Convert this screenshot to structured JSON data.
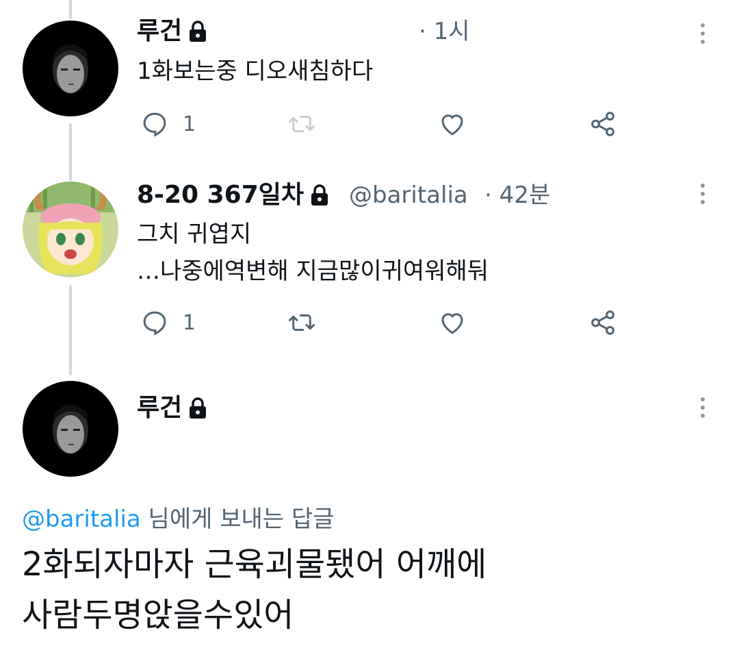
{
  "tweets": [
    {
      "name": "루건",
      "handle": "",
      "time": "· 1시",
      "lines": [
        "1화보는중 디오새침하다"
      ],
      "reply_count": "1"
    },
    {
      "name": "8-20 367일차",
      "handle": "@baritalia",
      "time": "· 42분",
      "lines": [
        "그치 귀엽지",
        "…나중에역변해 지금많이귀여워해둬"
      ],
      "reply_count": "1"
    }
  ],
  "composer": {
    "name": "루건",
    "reply_mention": "@baritalia",
    "reply_suffix": " 님에게 보내는 답글",
    "lines": [
      "2화되자마자 근육괴물됐어 어깨에",
      "사람두명앉을수있어"
    ]
  },
  "icons": [
    "lock-icon",
    "reply-icon",
    "retweet-icon",
    "like-icon",
    "share-icon",
    "more-icon"
  ],
  "colors": {
    "mention": "#1d9bf0",
    "secondary": "#536471",
    "thread_line": "#cfd9de"
  }
}
